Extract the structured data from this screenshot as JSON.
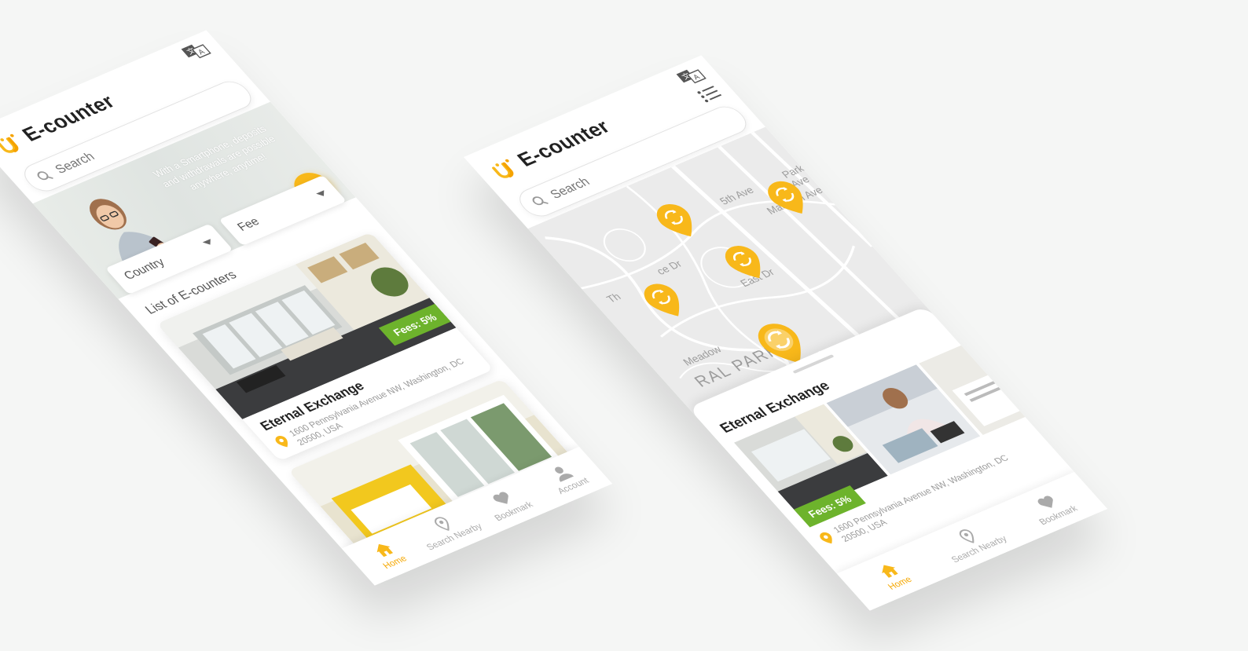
{
  "app": {
    "name": "E-counter"
  },
  "colors": {
    "accent": "#f8b81a",
    "fee_badge": "#6db32c",
    "text_dark": "#222222",
    "text_muted": "#999999"
  },
  "home_screen": {
    "search": {
      "placeholder": "Search"
    },
    "hero": {
      "text": "With a Smartphone, deposits and withdrawals are possible anywhere, anytime!"
    },
    "filters": [
      "Country",
      "Fee"
    ],
    "list_label": "List of E-counters",
    "cards": [
      {
        "fee": "Fees: 5%",
        "title": "Eternal Exchange",
        "address": "1600 Pennsylvania Avenue NW, Washington, DC 20500, USA"
      }
    ]
  },
  "map_screen": {
    "search": {
      "placeholder": "Search"
    },
    "map_labels": [
      "Th",
      "ce Dr",
      "East Dr",
      "5th Ave",
      "Madison Ave",
      "Park Ave",
      "Meadow",
      "RAL PARK"
    ],
    "selected": {
      "title": "Eternal Exchange",
      "fee": "Fees: 5%",
      "address": "1600 Pennsylvania Avenue NW, Washington, DC 20500, USA"
    }
  },
  "bottom_nav": {
    "home": [
      {
        "label": "Home",
        "icon": "home-icon",
        "active": true
      },
      {
        "label": "Search Nearby",
        "icon": "location-pin-icon",
        "active": false
      },
      {
        "label": "Bookmark",
        "icon": "heart-icon",
        "active": false
      },
      {
        "label": "Account",
        "icon": "user-icon",
        "active": false
      }
    ],
    "map": [
      {
        "label": "Home",
        "icon": "home-icon",
        "active": true
      },
      {
        "label": "Search Nearby",
        "icon": "location-pin-icon",
        "active": false
      },
      {
        "label": "Bookmark",
        "icon": "heart-icon",
        "active": false
      }
    ]
  }
}
